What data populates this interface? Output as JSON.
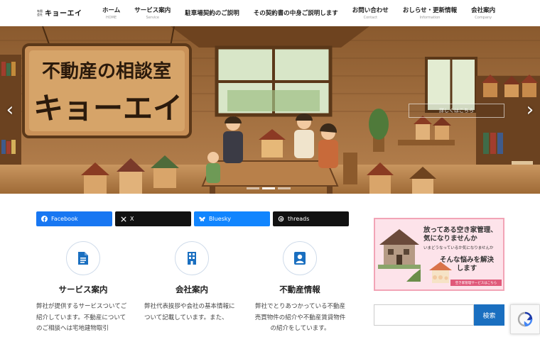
{
  "header": {
    "logo_small_line1": "有限",
    "logo_small_line2": "会社",
    "logo_name": "キョーエイ",
    "nav": [
      {
        "label": "ホーム",
        "sub": "HOME"
      },
      {
        "label": "サービス案内",
        "sub": "Service"
      },
      {
        "label": "駐車場契約のご説明",
        "sub": ""
      },
      {
        "label": "その契約書の中身ご説明します",
        "sub": ""
      },
      {
        "label": "お問い合わせ",
        "sub": "Contact"
      },
      {
        "label": "おしらせ・更新情報",
        "sub": "Information"
      },
      {
        "label": "会社案内",
        "sub": "Company"
      }
    ]
  },
  "hero": {
    "sign_line1": "不動産の相談室",
    "sign_line2": "キョーエイ",
    "overlay_button": "詳しくはこちら",
    "prev_icon": "chevron-left-icon",
    "next_icon": "chevron-right-icon",
    "slide_count": 3,
    "active_slide": 1
  },
  "share": {
    "facebook": "Facebook",
    "x": "X",
    "bluesky": "Bluesky",
    "threads": "threads"
  },
  "features": [
    {
      "icon": "document-icon",
      "title": "サービス案内",
      "text": "弊社が提供するサービスついてご紹介しています。不動産についてのご相談へは宅地建物取引"
    },
    {
      "icon": "building-icon",
      "title": "会社案内",
      "text": "弊社代表挨拶や会社の基本情報について記載しています。また、"
    },
    {
      "icon": "person-icon",
      "title": "不動産情報",
      "text": "弊社でとりあつかっている不動産売買物件の紹介や不動産賃貸物件の紹介をしています。"
    }
  ],
  "banner": {
    "line1": "放ってある空き家管理、気になりませんか",
    "line2": "いまどうなっているか気になりませんか",
    "line3": "そんな悩みを解決します",
    "line4": "空き家管理サービスはこちら"
  },
  "search": {
    "placeholder": "",
    "button": "検索"
  },
  "colors": {
    "accent": "#1a6fc0",
    "facebook": "#1877f2",
    "bluesky": "#1185fe",
    "banner_border": "#f2a4b6"
  }
}
